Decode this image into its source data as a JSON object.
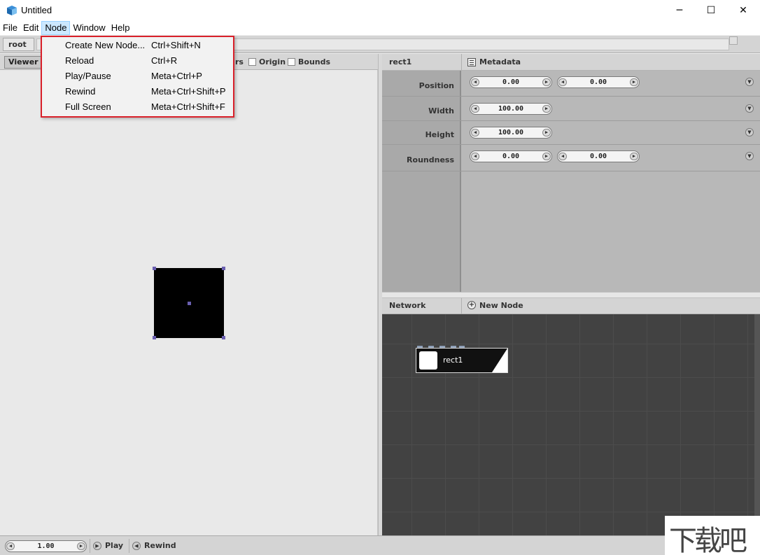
{
  "window": {
    "title": "Untitled",
    "minimize_glyph": "─",
    "maximize_glyph": "☐",
    "close_glyph": "✕"
  },
  "menubar": {
    "items": [
      "File",
      "Edit",
      "Node",
      "Window",
      "Help"
    ],
    "active": "Node"
  },
  "node_menu": {
    "items": [
      {
        "label": "Create New Node...",
        "shortcut": "Ctrl+Shift+N"
      },
      {
        "label": "Reload",
        "shortcut": "Ctrl+R"
      },
      {
        "label": "Play/Pause",
        "shortcut": "Meta+Ctrl+P"
      },
      {
        "label": "Rewind",
        "shortcut": "Meta+Ctrl+Shift+P"
      },
      {
        "label": "Full Screen",
        "shortcut": "Meta+Ctrl+Shift+F"
      }
    ]
  },
  "pathbar": {
    "crumb": "root"
  },
  "viewer": {
    "tab": "Viewer",
    "partial_label": "rs",
    "checks": [
      {
        "label": "Origin",
        "checked": false
      },
      {
        "label": "Bounds",
        "checked": false
      }
    ]
  },
  "inspector": {
    "node_name": "rect1",
    "metadata_label": "Metadata",
    "properties": [
      {
        "label": "Position",
        "values": [
          "0.00",
          "0.00"
        ]
      },
      {
        "label": "Width",
        "values": [
          "100.00"
        ]
      },
      {
        "label": "Height",
        "values": [
          "100.00"
        ]
      },
      {
        "label": "Roundness",
        "values": [
          "0.00",
          "0.00"
        ]
      }
    ]
  },
  "network": {
    "title": "Network",
    "new_node_label": "New Node",
    "node_label": "rect1"
  },
  "bottombar": {
    "time": "1.00",
    "play_label": "Play",
    "rewind_label": "Rewind"
  },
  "watermark": {
    "glyphs": "下载吧"
  },
  "icons": {
    "arrow_left": "◀",
    "arrow_right": "▶",
    "expand": "▼",
    "plus": "+",
    "play": "▶",
    "rewind": "◀"
  },
  "colors": {
    "menu_highlight_border": "#d9202a",
    "network_bg": "#424242",
    "shape_fill": "#000000",
    "handle": "#6a5fb0"
  }
}
